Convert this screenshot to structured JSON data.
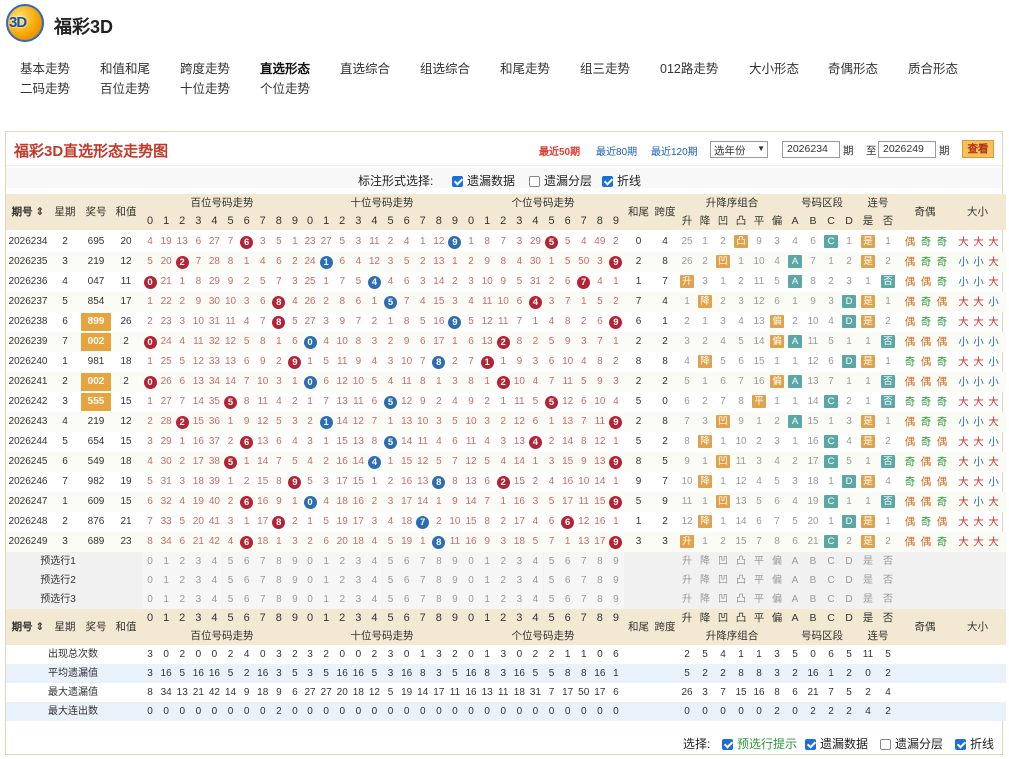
{
  "header": {
    "title": "福彩3D",
    "logo_text": "3D"
  },
  "nav": [
    {
      "label": "基本走势"
    },
    {
      "label": "和值和尾"
    },
    {
      "label": "跨度走势"
    },
    {
      "label": "直选形态"
    },
    {
      "label": "直选综合"
    },
    {
      "label": "组选综合"
    },
    {
      "label": "和尾走势"
    },
    {
      "label": "组三走势"
    },
    {
      "label": "012路走势"
    },
    {
      "label": "大小形态"
    },
    {
      "label": "奇偶形态"
    },
    {
      "label": "质合形态"
    },
    {
      "label": "二码走势"
    },
    {
      "label": "百位走势"
    },
    {
      "label": "十位走势"
    },
    {
      "label": "个位走势"
    }
  ],
  "panel": {
    "title": "福彩3D直选形态走势图",
    "periods": [
      "最近50期",
      "最近80期",
      "最近120期"
    ],
    "year_select": "选年份",
    "from": "2026234",
    "to": "2026249",
    "qi": "期",
    "zhi": "至",
    "btn": "查看",
    "opt_label": "标注形式选择:",
    "opts": [
      {
        "label": "遗漏数据",
        "checked": true
      },
      {
        "label": "遗漏分层",
        "checked": false
      },
      {
        "label": "折线",
        "checked": true
      }
    ]
  },
  "headers": {
    "period": "期号",
    "weekday": "星期",
    "number": "奖号",
    "sum": "和值",
    "bai": "百位号码走势",
    "shi": "十位号码走势",
    "ge": "个位号码走势",
    "hewei": "和尾",
    "span": "跨度",
    "shengjiang": "升降序组合",
    "zone": "号码区段",
    "lianhao": "连号",
    "jiou": "奇偶",
    "daxiao": "大小",
    "sj": [
      "升",
      "降",
      "凹",
      "凸",
      "平",
      "偏"
    ],
    "zones": [
      "A",
      "B",
      "C",
      "D"
    ],
    "lh": [
      "是",
      "否"
    ],
    "digits": [
      "0",
      "1",
      "2",
      "3",
      "4",
      "5",
      "6",
      "7",
      "8",
      "9"
    ]
  },
  "rows": [
    {
      "p": "2026234",
      "w": "2",
      "n": "695",
      "s": "20",
      "b": [
        4,
        19,
        13,
        6,
        27,
        7,
        6,
        3,
        5,
        1
      ],
      "t": [
        23,
        27,
        5,
        3,
        11,
        2,
        4,
        1,
        12,
        9
      ],
      "g": [
        1,
        8,
        7,
        3,
        29,
        5,
        5,
        4,
        49,
        2,
        6
      ],
      "hw": "0",
      "sp": "4",
      "sj": [
        "25",
        "1",
        "2",
        "凸",
        "9",
        "3"
      ],
      "z": [
        "4",
        "6",
        "C",
        "1"
      ],
      "lh": [
        "是",
        "1"
      ],
      "jo": [
        "偶",
        "奇",
        "奇"
      ],
      "dx": [
        "大",
        "大",
        "大"
      ]
    },
    {
      "p": "2026235",
      "w": "3",
      "n": "219",
      "s": "12",
      "b": [
        5,
        20,
        2,
        7,
        28,
        8,
        1,
        4,
        6,
        2
      ],
      "t": [
        24,
        1,
        6,
        4,
        12,
        3,
        5,
        2,
        13,
        1
      ],
      "g": [
        2,
        9,
        8,
        4,
        30,
        1,
        5,
        50,
        3,
        9
      ],
      "hw": "2",
      "sp": "8",
      "sj": [
        "26",
        "2",
        "凹",
        "1",
        "10",
        "4"
      ],
      "z": [
        "A",
        "7",
        "1",
        "2"
      ],
      "lh": [
        "是",
        "2"
      ],
      "jo": [
        "偶",
        "奇",
        "奇"
      ],
      "dx": [
        "小",
        "小",
        "大"
      ]
    },
    {
      "p": "2026236",
      "w": "4",
      "n": "047",
      "s": "11",
      "b": [
        0,
        21,
        1,
        8,
        29,
        9,
        2,
        5,
        7,
        3
      ],
      "t": [
        25,
        1,
        7,
        5,
        4,
        4,
        6,
        3,
        14,
        2
      ],
      "g": [
        3,
        10,
        9,
        5,
        31,
        2,
        6,
        7,
        4,
        1
      ],
      "hw": "1",
      "sp": "7",
      "sj": [
        "升",
        "3",
        "1",
        "2",
        "11",
        "5"
      ],
      "z": [
        "A",
        "8",
        "2",
        "3"
      ],
      "lh": [
        "1",
        "否"
      ],
      "jo": [
        "偶",
        "偶",
        "奇"
      ],
      "dx": [
        "小",
        "小",
        "大"
      ]
    },
    {
      "p": "2026237",
      "w": "5",
      "n": "854",
      "s": "17",
      "b": [
        1,
        22,
        2,
        9,
        30,
        10,
        3,
        6,
        8,
        4
      ],
      "t": [
        26,
        2,
        8,
        6,
        1,
        5,
        7,
        4,
        15,
        3
      ],
      "g": [
        4,
        11,
        10,
        6,
        4,
        3,
        7,
        1,
        5,
        2
      ],
      "hw": "7",
      "sp": "4",
      "sj": [
        "1",
        "降",
        "2",
        "3",
        "12",
        "6"
      ],
      "z": [
        "1",
        "9",
        "3",
        "D"
      ],
      "lh": [
        "是",
        "1"
      ],
      "jo": [
        "偶",
        "奇",
        "偶"
      ],
      "dx": [
        "大",
        "大",
        "小"
      ]
    },
    {
      "p": "2026238",
      "w": "6",
      "n": "899",
      "s": "26",
      "b": [
        2,
        23,
        3,
        10,
        31,
        11,
        4,
        7,
        8,
        5
      ],
      "t": [
        27,
        3,
        9,
        7,
        2,
        1,
        8,
        5,
        16,
        9
      ],
      "g": [
        5,
        12,
        11,
        7,
        1,
        4,
        8,
        2,
        6,
        9
      ],
      "hw": "6",
      "sp": "1",
      "sj": [
        "2",
        "1",
        "3",
        "4",
        "13",
        "偏"
      ],
      "z": [
        "2",
        "10",
        "4",
        "D"
      ],
      "lh": [
        "是",
        "2"
      ],
      "jo": [
        "偶",
        "奇",
        "奇"
      ],
      "dx": [
        "大",
        "大",
        "大"
      ]
    },
    {
      "p": "2026239",
      "w": "7",
      "n": "002",
      "s": "2",
      "b": [
        0,
        24,
        4,
        11,
        32,
        12,
        5,
        8,
        1,
        6
      ],
      "t": [
        0,
        4,
        10,
        8,
        3,
        2,
        9,
        6,
        17,
        1
      ],
      "g": [
        6,
        13,
        2,
        8,
        2,
        5,
        9,
        3,
        7,
        1
      ],
      "hw": "2",
      "sp": "2",
      "sj": [
        "3",
        "2",
        "4",
        "5",
        "14",
        "偏"
      ],
      "z": [
        "A",
        "11",
        "5",
        "1"
      ],
      "lh": [
        "1",
        "否"
      ],
      "jo": [
        "偶",
        "偶",
        "偶"
      ],
      "dx": [
        "小",
        "小",
        "小"
      ]
    },
    {
      "p": "2026240",
      "w": "1",
      "n": "981",
      "s": "18",
      "b": [
        1,
        25,
        5,
        12,
        33,
        13,
        6,
        9,
        2,
        9
      ],
      "t": [
        1,
        5,
        11,
        9,
        4,
        3,
        10,
        7,
        8,
        2
      ],
      "g": [
        7,
        1,
        1,
        9,
        3,
        6,
        10,
        4,
        8,
        2
      ],
      "hw": "8",
      "sp": "8",
      "sj": [
        "4",
        "降",
        "5",
        "6",
        "15",
        "1"
      ],
      "z": [
        "1",
        "12",
        "6",
        "D"
      ],
      "lh": [
        "是",
        "1"
      ],
      "jo": [
        "奇",
        "偶",
        "奇"
      ],
      "dx": [
        "大",
        "大",
        "小"
      ]
    },
    {
      "p": "2026241",
      "w": "2",
      "n": "002",
      "s": "2",
      "b": [
        0,
        26,
        6,
        13,
        34,
        14,
        7,
        10,
        3,
        1
      ],
      "t": [
        0,
        6,
        12,
        10,
        5,
        4,
        11,
        8,
        1,
        3
      ],
      "g": [
        8,
        1,
        2,
        10,
        4,
        7,
        11,
        5,
        9,
        3
      ],
      "hw": "2",
      "sp": "2",
      "sj": [
        "5",
        "1",
        "6",
        "7",
        "16",
        "偏"
      ],
      "z": [
        "A",
        "13",
        "7",
        "1"
      ],
      "lh": [
        "1",
        "否"
      ],
      "jo": [
        "偶",
        "偶",
        "偶"
      ],
      "dx": [
        "小",
        "小",
        "小"
      ]
    },
    {
      "p": "2026242",
      "w": "3",
      "n": "555",
      "s": "15",
      "b": [
        1,
        27,
        7,
        14,
        35,
        5,
        8,
        11,
        4,
        2
      ],
      "t": [
        1,
        7,
        13,
        11,
        6,
        5,
        12,
        9,
        2,
        4
      ],
      "g": [
        9,
        2,
        1,
        11,
        5,
        5,
        12,
        6,
        10,
        4
      ],
      "hw": "5",
      "sp": "0",
      "sj": [
        "6",
        "2",
        "7",
        "8",
        "平",
        "1"
      ],
      "z": [
        "1",
        "14",
        "C",
        "2"
      ],
      "lh": [
        "1",
        "否"
      ],
      "jo": [
        "奇",
        "奇",
        "奇"
      ],
      "dx": [
        "大",
        "大",
        "大"
      ]
    },
    {
      "p": "2026243",
      "w": "4",
      "n": "219",
      "s": "12",
      "b": [
        2,
        28,
        2,
        15,
        36,
        1,
        9,
        12,
        5,
        3
      ],
      "t": [
        2,
        1,
        14,
        12,
        7,
        1,
        13,
        10,
        3,
        5
      ],
      "g": [
        10,
        3,
        2,
        12,
        6,
        1,
        13,
        7,
        11,
        9
      ],
      "hw": "2",
      "sp": "8",
      "sj": [
        "7",
        "3",
        "凹",
        "9",
        "1",
        "2"
      ],
      "z": [
        "A",
        "15",
        "1",
        "3"
      ],
      "lh": [
        "是",
        "1"
      ],
      "jo": [
        "偶",
        "奇",
        "奇"
      ],
      "dx": [
        "小",
        "小",
        "大"
      ]
    },
    {
      "p": "2026244",
      "w": "5",
      "n": "654",
      "s": "15",
      "b": [
        3,
        29,
        1,
        16,
        37,
        2,
        6,
        13,
        6,
        4
      ],
      "t": [
        3,
        1,
        15,
        13,
        8,
        5,
        14,
        11,
        4,
        6
      ],
      "g": [
        11,
        4,
        3,
        13,
        4,
        2,
        14,
        8,
        12,
        1
      ],
      "hw": "5",
      "sp": "2",
      "sj": [
        "8",
        "降",
        "1",
        "10",
        "2",
        "3"
      ],
      "z": [
        "1",
        "16",
        "C",
        "4"
      ],
      "lh": [
        "是",
        "2"
      ],
      "jo": [
        "偶",
        "奇",
        "偶"
      ],
      "dx": [
        "大",
        "大",
        "小"
      ]
    },
    {
      "p": "2026245",
      "w": "6",
      "n": "549",
      "s": "18",
      "b": [
        4,
        30,
        2,
        17,
        38,
        5,
        1,
        14,
        7,
        5
      ],
      "t": [
        4,
        2,
        16,
        14,
        4,
        1,
        15,
        12,
        5,
        7
      ],
      "g": [
        12,
        5,
        4,
        14,
        1,
        3,
        15,
        9,
        13,
        9
      ],
      "hw": "8",
      "sp": "5",
      "sj": [
        "9",
        "1",
        "凹",
        "11",
        "3",
        "4"
      ],
      "z": [
        "2",
        "17",
        "C",
        "5"
      ],
      "lh": [
        "1",
        "否"
      ],
      "jo": [
        "奇",
        "偶",
        "奇"
      ],
      "dx": [
        "大",
        "小",
        "大"
      ]
    },
    {
      "p": "2026246",
      "w": "7",
      "n": "982",
      "s": "19",
      "b": [
        5,
        31,
        3,
        18,
        39,
        1,
        2,
        15,
        8,
        9
      ],
      "t": [
        5,
        3,
        17,
        15,
        1,
        2,
        16,
        13,
        8,
        8
      ],
      "g": [
        13,
        6,
        2,
        15,
        2,
        4,
        16,
        10,
        14,
        1
      ],
      "hw": "9",
      "sp": "7",
      "sj": [
        "10",
        "降",
        "1",
        "12",
        "4",
        "5"
      ],
      "z": [
        "3",
        "18",
        "1",
        "D"
      ],
      "lh": [
        "是",
        "4"
      ],
      "jo": [
        "奇",
        "偶",
        "偶"
      ],
      "dx": [
        "大",
        "大",
        "小"
      ]
    },
    {
      "p": "2026247",
      "w": "1",
      "n": "609",
      "s": "15",
      "b": [
        6,
        32,
        4,
        19,
        40,
        2,
        6,
        16,
        9,
        1
      ],
      "t": [
        0,
        4,
        18,
        16,
        2,
        3,
        17,
        14,
        1,
        9
      ],
      "g": [
        14,
        7,
        1,
        16,
        3,
        5,
        17,
        11,
        15,
        9
      ],
      "hw": "5",
      "sp": "9",
      "sj": [
        "11",
        "1",
        "凹",
        "13",
        "5",
        "6"
      ],
      "z": [
        "4",
        "19",
        "C",
        "1"
      ],
      "lh": [
        "1",
        "否"
      ],
      "jo": [
        "偶",
        "偶",
        "奇"
      ],
      "dx": [
        "大",
        "小",
        "大"
      ]
    },
    {
      "p": "2026248",
      "w": "2",
      "n": "876",
      "s": "21",
      "b": [
        7,
        33,
        5,
        20,
        41,
        3,
        1,
        17,
        8,
        2
      ],
      "t": [
        1,
        5,
        19,
        17,
        3,
        4,
        18,
        7,
        2,
        10
      ],
      "g": [
        15,
        8,
        2,
        17,
        4,
        6,
        6,
        12,
        16,
        1
      ],
      "hw": "1",
      "sp": "2",
      "sj": [
        "12",
        "降",
        "1",
        "14",
        "6",
        "7"
      ],
      "z": [
        "5",
        "20",
        "1",
        "D"
      ],
      "lh": [
        "是",
        "1"
      ],
      "jo": [
        "偶",
        "奇",
        "偶"
      ],
      "dx": [
        "大",
        "大",
        "大"
      ]
    },
    {
      "p": "2026249",
      "w": "3",
      "n": "689",
      "s": "23",
      "b": [
        8,
        34,
        6,
        21,
        42,
        4,
        6,
        18,
        1,
        3
      ],
      "t": [
        2,
        6,
        20,
        18,
        4,
        5,
        19,
        1,
        8,
        11
      ],
      "g": [
        16,
        9,
        3,
        18,
        5,
        7,
        1,
        13,
        17,
        9
      ],
      "hw": "3",
      "sp": "3",
      "sj": [
        "升",
        "1",
        "2",
        "15",
        "7",
        "8"
      ],
      "z": [
        "6",
        "21",
        "C",
        "2"
      ],
      "lh": [
        "是",
        "2"
      ],
      "jo": [
        "偶",
        "偶",
        "奇"
      ],
      "dx": [
        "大",
        "大",
        "大"
      ]
    }
  ],
  "pre_rows": [
    "预选行1",
    "预选行2",
    "预选行3"
  ],
  "stats": [
    {
      "label": "出现总次数",
      "b": [
        3,
        0,
        2,
        0,
        0,
        2,
        4,
        0,
        3,
        2
      ],
      "t": [
        3,
        2,
        0,
        0,
        2,
        3,
        0,
        1,
        3,
        2
      ],
      "g": [
        0,
        1,
        3,
        0,
        2,
        2,
        1,
        1,
        0,
        6
      ],
      "sj": [
        2,
        5,
        4,
        1,
        1,
        3
      ],
      "z": [
        5,
        0,
        6,
        5
      ],
      "lh": [
        11,
        5
      ]
    },
    {
      "label": "平均遗漏值",
      "b": [
        3,
        16,
        5,
        16,
        16,
        5,
        2,
        16,
        3,
        5
      ],
      "t": [
        3,
        5,
        16,
        16,
        5,
        3,
        16,
        8,
        3,
        5
      ],
      "g": [
        16,
        8,
        3,
        16,
        5,
        5,
        8,
        8,
        16,
        1
      ],
      "sj": [
        5,
        2,
        2,
        8,
        8,
        3
      ],
      "z": [
        2,
        16,
        1,
        2
      ],
      "lh": [
        0,
        2
      ]
    },
    {
      "label": "最大遗漏值",
      "b": [
        8,
        34,
        13,
        21,
        42,
        14,
        9,
        18,
        9,
        6
      ],
      "t": [
        27,
        27,
        20,
        18,
        12,
        5,
        19,
        14,
        17,
        11
      ],
      "g": [
        16,
        13,
        11,
        18,
        31,
        7,
        17,
        50,
        17,
        6
      ],
      "sj": [
        26,
        3,
        7,
        15,
        16,
        8
      ],
      "z": [
        6,
        21,
        7,
        5
      ],
      "lh": [
        2,
        4
      ]
    },
    {
      "label": "最大连出数",
      "b": [
        0,
        0,
        0,
        0,
        0,
        0,
        0,
        0,
        2,
        0
      ],
      "t": [
        0,
        0,
        0,
        0,
        0,
        0,
        0,
        0,
        0,
        0
      ],
      "g": [
        0,
        0,
        0,
        0,
        0,
        0,
        0,
        0,
        0,
        0
      ],
      "sj": [
        0,
        0,
        0,
        0,
        0,
        2
      ],
      "z": [
        0,
        2,
        2,
        2
      ],
      "lh": [
        4,
        2
      ]
    }
  ],
  "bottom": {
    "label": "选择:",
    "opts": [
      {
        "label": "预选行提示",
        "checked": true,
        "green": true
      },
      {
        "label": "遗漏数据",
        "checked": true
      },
      {
        "label": "遗漏分层",
        "checked": false
      },
      {
        "label": "折线",
        "checked": true
      }
    ]
  },
  "colors": {
    "bai_ball": "#b52233",
    "shi_ball": "#2a6db5",
    "ge_ball": "#b52233",
    "tag_orange": "#e0a24b",
    "tag_teal": "#5aa7a5",
    "odd": "#2b9a3a",
    "even": "#d26b1c",
    "big": "#d0302b",
    "small": "#2a6db5",
    "miss": "#c76b6b",
    "highlight": "#e7a33d"
  }
}
